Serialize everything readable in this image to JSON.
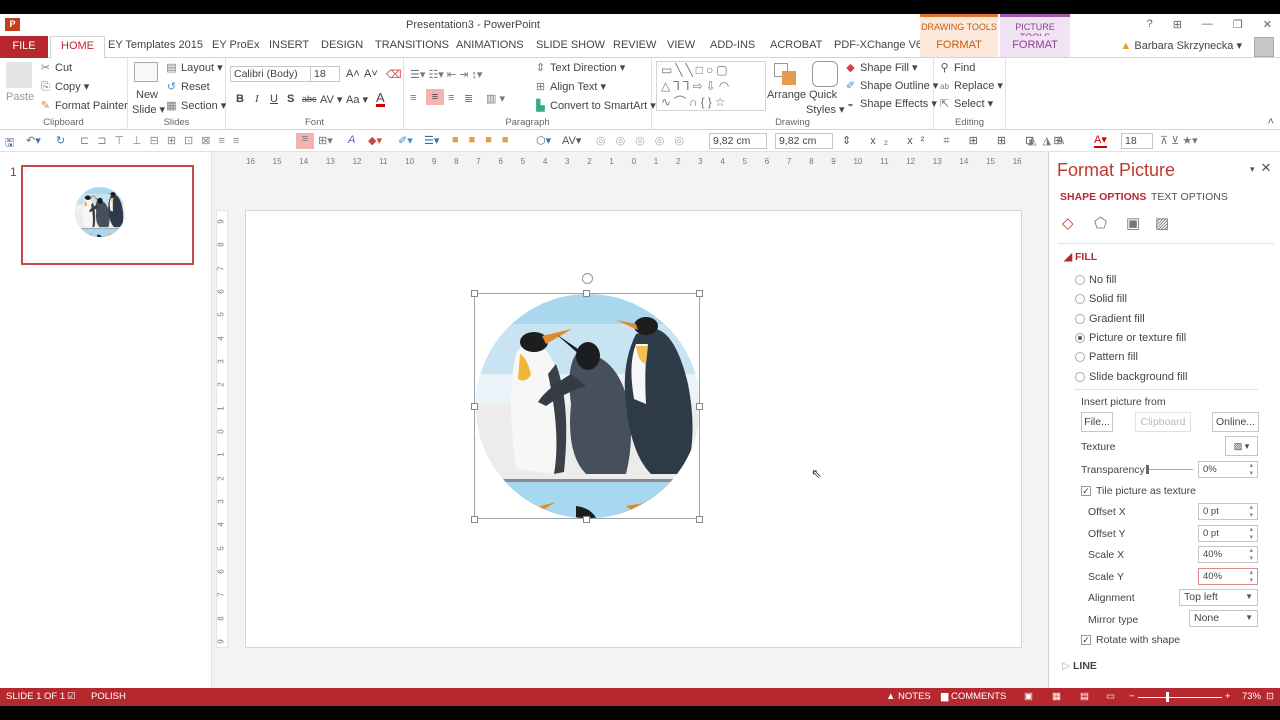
{
  "window": {
    "title": "Presentation3 - PowerPoint",
    "app_icon": "P",
    "controls": [
      "?",
      "ribbon-display",
      "minimize",
      "restore",
      "close"
    ]
  },
  "contextual_tabs": {
    "drawing_tools": {
      "group": "DRAWING TOOLS",
      "tab": "FORMAT",
      "color": "#e0752e"
    },
    "picture_tools": {
      "group": "PICTURE TOOLS",
      "tab": "FORMAT",
      "color": "#a05aa8"
    }
  },
  "tabs": [
    "FILE",
    "HOME",
    "EY Templates 2015",
    "EY ProEx",
    "INSERT",
    "DESIGN",
    "TRANSITIONS",
    "ANIMATIONS",
    "SLIDE SHOW",
    "REVIEW",
    "VIEW",
    "ADD-INS",
    "ACROBAT",
    "PDF-XChange V6"
  ],
  "active_tab": "HOME",
  "user": {
    "name": "Barbara Skrzynecka"
  },
  "ribbon": {
    "clipboard": {
      "label": "Clipboard",
      "paste": "Paste",
      "cut": "Cut",
      "copy": "Copy",
      "format_painter": "Format Painter"
    },
    "slides": {
      "label": "Slides",
      "new_slide": "New",
      "new_slide2": "Slide",
      "layout": "Layout",
      "reset": "Reset",
      "section": "Section"
    },
    "font": {
      "label": "Font",
      "font_name": "Calibri (Body)",
      "font_size": "18",
      "bold": "B",
      "italic": "I",
      "underline": "U",
      "shadow": "S",
      "strike": "abc",
      "spacing": "AV",
      "case": "Aa",
      "color": "A"
    },
    "paragraph": {
      "label": "Paragraph",
      "text_direction": "Text Direction",
      "align_text": "Align Text",
      "smartart": "Convert to SmartArt"
    },
    "drawing": {
      "label": "Drawing",
      "arrange": "Arrange",
      "quick_styles": "Quick",
      "quick_styles2": "Styles",
      "shape_fill": "Shape Fill",
      "shape_outline": "Shape Outline",
      "shape_effects": "Shape Effects"
    },
    "editing": {
      "label": "Editing",
      "find": "Find",
      "replace": "Replace",
      "select": "Select"
    }
  },
  "quick_toolbar": {
    "height": "9,82 cm",
    "width": "9,82 cm",
    "font_size": "18"
  },
  "ruler": {
    "horizontal": [
      "16",
      "15",
      "14",
      "13",
      "12",
      "11",
      "10",
      "9",
      "8",
      "7",
      "6",
      "5",
      "4",
      "3",
      "2",
      "1",
      "0",
      "1",
      "2",
      "3",
      "4",
      "5",
      "6",
      "7",
      "8",
      "9",
      "10",
      "11",
      "12",
      "13",
      "14",
      "15",
      "16"
    ],
    "vertical": [
      "9",
      "8",
      "7",
      "6",
      "5",
      "4",
      "3",
      "2",
      "1",
      "0",
      "1",
      "2",
      "3",
      "4",
      "5",
      "6",
      "7",
      "8",
      "9"
    ]
  },
  "thumbnails": [
    {
      "number": "1"
    }
  ],
  "format_pane": {
    "title": "Format Picture",
    "tabs": {
      "shape": "SHAPE OPTIONS",
      "text": "TEXT OPTIONS"
    },
    "fill_section": "FILL",
    "fill_options": [
      {
        "label": "No fill",
        "selected": false
      },
      {
        "label": "Solid fill",
        "selected": false
      },
      {
        "label": "Gradient fill",
        "selected": false
      },
      {
        "label": "Picture or texture fill",
        "selected": true
      },
      {
        "label": "Pattern fill",
        "selected": false
      },
      {
        "label": "Slide background fill",
        "selected": false
      }
    ],
    "insert_from": "Insert picture from",
    "buttons": {
      "file": "File...",
      "clipboard": "Clipboard",
      "online": "Online..."
    },
    "texture_label": "Texture",
    "transparency": {
      "label": "Transparency",
      "value": "0%"
    },
    "tile": {
      "label": "Tile picture as texture",
      "checked": true
    },
    "offset_x": {
      "label": "Offset X",
      "value": "0 pt"
    },
    "offset_y": {
      "label": "Offset Y",
      "value": "0 pt"
    },
    "scale_x": {
      "label": "Scale X",
      "value": "40%"
    },
    "scale_y": {
      "label": "Scale Y",
      "value": "40%"
    },
    "alignment": {
      "label": "Alignment",
      "value": "Top left"
    },
    "mirror": {
      "label": "Mirror type",
      "value": "None"
    },
    "rotate": {
      "label": "Rotate with shape",
      "checked": true
    },
    "line_section": "LINE"
  },
  "status": {
    "slide": "SLIDE 1 OF 1",
    "language": "POLISH",
    "notes": "NOTES",
    "comments": "COMMENTS",
    "zoom": "73%",
    "zoom_fraction": 0.35
  }
}
